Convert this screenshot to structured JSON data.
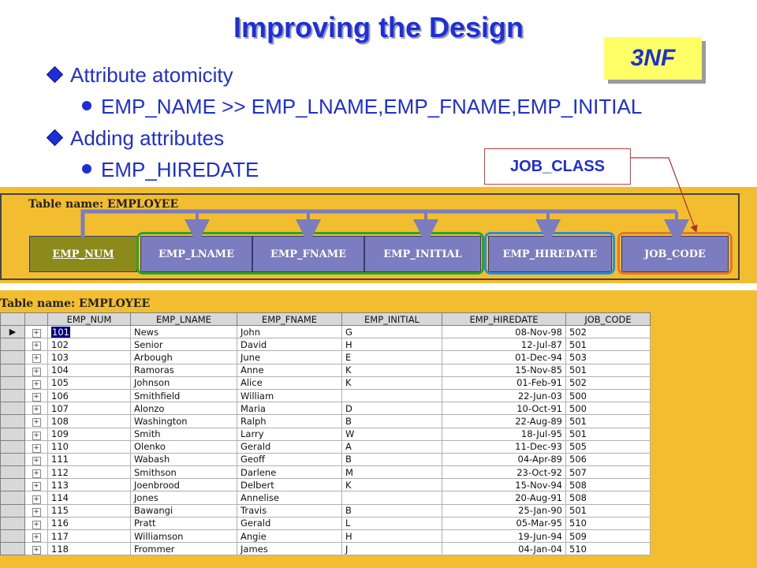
{
  "title": "Improving the Design",
  "badge": "3NF",
  "bullets": {
    "b1": "Attribute atomicity",
    "b1_sub": "EMP_NAME >> EMP_LNAME,EMP_FNAME,EMP_INITIAL",
    "b2": "Adding attributes",
    "b2_sub": "EMP_HIREDATE"
  },
  "callout": "JOB_CLASS",
  "diagram": {
    "label": "Table name: EMPLOYEE",
    "columns": [
      "EMP_NUM",
      "EMP_LNAME",
      "EMP_FNAME",
      "EMP_INITIAL",
      "EMP_HIREDATE",
      "JOB_CODE"
    ]
  },
  "table": {
    "label": "Table name: EMPLOYEE",
    "headers": [
      "EMP_NUM",
      "EMP_LNAME",
      "EMP_FNAME",
      "EMP_INITIAL",
      "EMP_HIREDATE",
      "JOB_CODE"
    ],
    "rows": [
      [
        "101",
        "News",
        "John",
        "G",
        "08-Nov-98",
        "502"
      ],
      [
        "102",
        "Senior",
        "David",
        "H",
        "12-Jul-87",
        "501"
      ],
      [
        "103",
        "Arbough",
        "June",
        "E",
        "01-Dec-94",
        "503"
      ],
      [
        "104",
        "Ramoras",
        "Anne",
        "K",
        "15-Nov-85",
        "501"
      ],
      [
        "105",
        "Johnson",
        "Alice",
        "K",
        "01-Feb-91",
        "502"
      ],
      [
        "106",
        "Smithfield",
        "William",
        "",
        "22-Jun-03",
        "500"
      ],
      [
        "107",
        "Alonzo",
        "Maria",
        "D",
        "10-Oct-91",
        "500"
      ],
      [
        "108",
        "Washington",
        "Ralph",
        "B",
        "22-Aug-89",
        "501"
      ],
      [
        "109",
        "Smith",
        "Larry",
        "W",
        "18-Jul-95",
        "501"
      ],
      [
        "110",
        "Olenko",
        "Gerald",
        "A",
        "11-Dec-93",
        "505"
      ],
      [
        "111",
        "Wabash",
        "Geoff",
        "B",
        "04-Apr-89",
        "506"
      ],
      [
        "112",
        "Smithson",
        "Darlene",
        "M",
        "23-Oct-92",
        "507"
      ],
      [
        "113",
        "Joenbrood",
        "Delbert",
        "K",
        "15-Nov-94",
        "508"
      ],
      [
        "114",
        "Jones",
        "Annelise",
        "",
        "20-Aug-91",
        "508"
      ],
      [
        "115",
        "Bawangi",
        "Travis",
        "B",
        "25-Jan-90",
        "501"
      ],
      [
        "116",
        "Pratt",
        "Gerald",
        "L",
        "05-Mar-95",
        "510"
      ],
      [
        "117",
        "Williamson",
        "Angie",
        "H",
        "19-Jun-94",
        "509"
      ],
      [
        "118",
        "Frommer",
        "James",
        "J",
        "04-Jan-04",
        "510"
      ]
    ]
  },
  "colors": {
    "title": "#1f2fd6",
    "badge_bg": "#ffff66",
    "panel": "#f2bd2e",
    "pk_cell": "#8b8a1a",
    "attr_cell": "#7c7cc0",
    "group_green": "#2aa52a",
    "group_blue": "#2a8ee0",
    "group_orange": "#e07a2a"
  }
}
